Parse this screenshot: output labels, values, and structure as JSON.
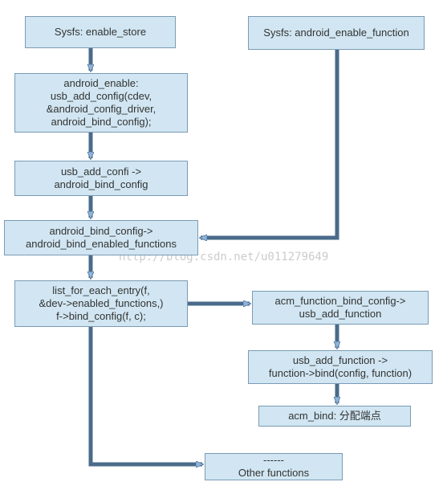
{
  "watermark": "http://blog.csdn.net/u011279649",
  "boxes": {
    "n1": "Sysfs: enable_store",
    "n2": "Sysfs: android_enable_function",
    "n3": "android_enable:\nusb_add_config(cdev,\n    &android_config_driver,\nandroid_bind_config);",
    "n4": "usb_add_confi ->\nandroid_bind_config",
    "n5": "android_bind_config->\nandroid_bind_enabled_functions",
    "n6": "list_for_each_entry(f,\n&dev->enabled_functions,)\nf->bind_config(f, c);",
    "n7": "acm_function_bind_config->\nusb_add_function",
    "n8": "usb_add_function ->\nfunction->bind(config, function)",
    "n9": "acm_bind: 分配端点",
    "n10": "------\nOther functions"
  }
}
